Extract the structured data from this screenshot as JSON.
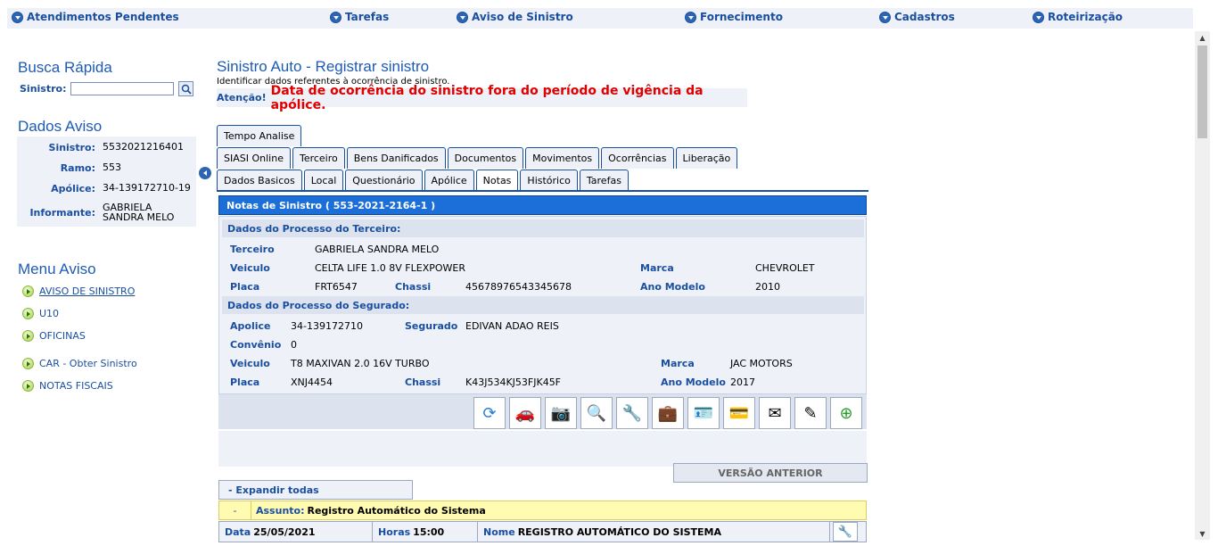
{
  "nav": {
    "items": [
      {
        "label": "Atendimentos Pendentes"
      },
      {
        "label": "Tarefas"
      },
      {
        "label": "Aviso de Sinistro"
      },
      {
        "label": "Fornecimento"
      },
      {
        "label": "Cadastros"
      },
      {
        "label": "Roteirização"
      }
    ]
  },
  "left": {
    "busca_title": "Busca Rápida",
    "busca_label": "Sinistro:",
    "busca_value": "",
    "dados_title": "Dados Aviso",
    "dados": [
      {
        "label": "Sinistro:",
        "value": "5532021216401"
      },
      {
        "label": "Ramo:",
        "value": "553"
      },
      {
        "label": "Apólice:",
        "value": "34-139172710-19"
      },
      {
        "label": "Informante:",
        "value": "GABRIELA SANDRA MELO"
      }
    ],
    "menu_title": "Menu Aviso",
    "menu": [
      {
        "label": "AVISO DE SINISTRO",
        "link": true
      },
      {
        "label": "U10"
      },
      {
        "label": "OFICINAS"
      },
      {
        "label": "CAR - Obter Sinistro"
      },
      {
        "label": "NOTAS FISCAIS"
      }
    ]
  },
  "main": {
    "title": "Sinistro Auto - Registrar sinistro",
    "subtitle": "Identificar dados referentes à ocorrência de sinistro.",
    "alert_label": "Atenção!",
    "alert_text": "Data de ocorrência do sinistro fora do período de vigência da apólice.",
    "tabs_row1": [
      "Tempo Analise"
    ],
    "tabs_row2": [
      "SIASI Online",
      "Terceiro",
      "Bens Danificados",
      "Documentos",
      "Movimentos",
      "Ocorrências",
      "Liberação"
    ],
    "tabs_row3": [
      "Dados Basicos",
      "Local",
      "Questionário",
      "Apólice",
      "Notas",
      "Histórico",
      "Tarefas"
    ],
    "active_tab": "Notas",
    "panel_header": "Notas de Sinistro  (   553-2021-2164-1   )",
    "terceiro": {
      "title": "Dados do Processo do Terceiro:",
      "terceiro_label": "Terceiro",
      "terceiro": "GABRIELA SANDRA MELO",
      "veiculo_label": "Veiculo",
      "veiculo": "CELTA LIFE 1.0 8V FLEXPOWER",
      "marca_label": "Marca",
      "marca": "CHEVROLET",
      "placa_label": "Placa",
      "placa": "FRT6547",
      "chassi_label": "Chassi",
      "chassi": "45678976543345678",
      "ano_label": "Ano Modelo",
      "ano": "2010"
    },
    "segurado": {
      "title": "Dados do Processo do Segurado:",
      "apolice_label": "Apolice",
      "apolice": "34-139172710",
      "segurado_label": "Segurado",
      "segurado": "EDIVAN ADAO REIS",
      "convenio_label": "Convênio",
      "convenio": "0",
      "veiculo_label": "Veiculo",
      "veiculo": "T8 MAXIVAN 2.0 16V TURBO",
      "marca_label": "Marca",
      "marca": "JAC MOTORS",
      "placa_label": "Placa",
      "placa": "XNJ4454",
      "chassi_label": "Chassi",
      "chassi": "K43J534KJ53FJK45F",
      "ano_label": "Ano Modelo",
      "ano": "2017"
    },
    "toolbar_icons": [
      "refresh-icon",
      "car-icon",
      "camera-icon",
      "document-search-icon",
      "tools-icon",
      "briefcase-icon",
      "id-card-icon",
      "credit-card-icon",
      "pdf-mail-icon",
      "edit-icon",
      "add-document-icon"
    ],
    "versao_anterior": "VERSÃO ANTERIOR",
    "expandir": "-  Expandir todas",
    "assunto_toggle": "-",
    "assunto_label": "Assunto:",
    "assunto_value": "Registro Automático do Sistema",
    "note_row": {
      "data_label": "Data",
      "data": "25/05/2021",
      "horas_label": "Horas",
      "horas": "15:00",
      "nome_label": "Nome",
      "nome": "REGISTRO AUTOMÁTICO DO SISTEMA"
    }
  }
}
